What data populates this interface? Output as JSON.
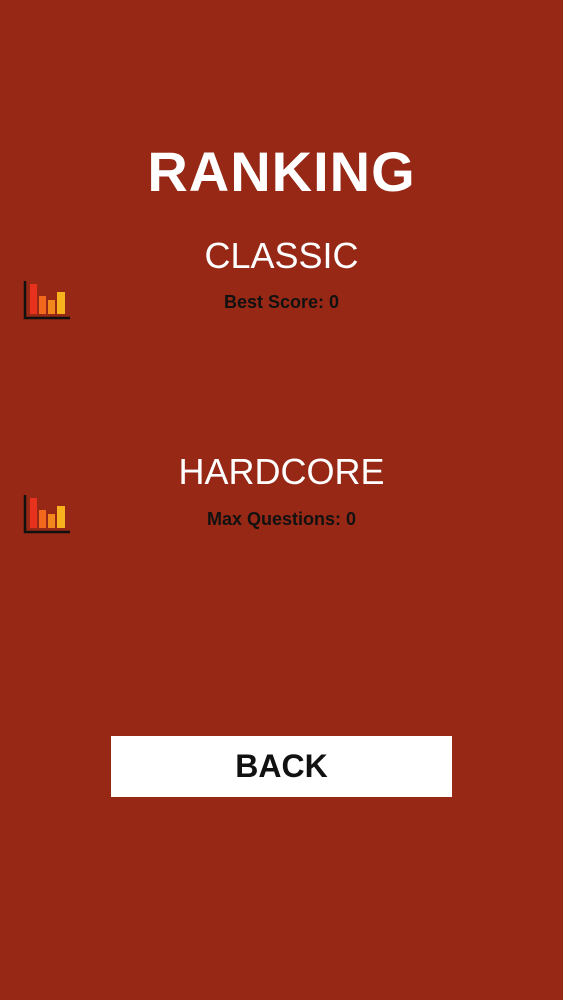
{
  "screen": {
    "title": "RANKING",
    "background_color": "#962815"
  },
  "classic": {
    "title": "CLASSIC",
    "score_text": "Best Score: 0",
    "icon": "leaderboard-icon"
  },
  "hardcore": {
    "title": "HARDCORE",
    "score_text": "Max Questions: 0",
    "icon": "leaderboard-icon"
  },
  "back_button": {
    "label": "BACK"
  },
  "icon_colors": {
    "bar_red": "#e8321e",
    "bar_orange": "#f2681c",
    "bar_yellow": "#f7b21e",
    "axis": "#111111"
  }
}
